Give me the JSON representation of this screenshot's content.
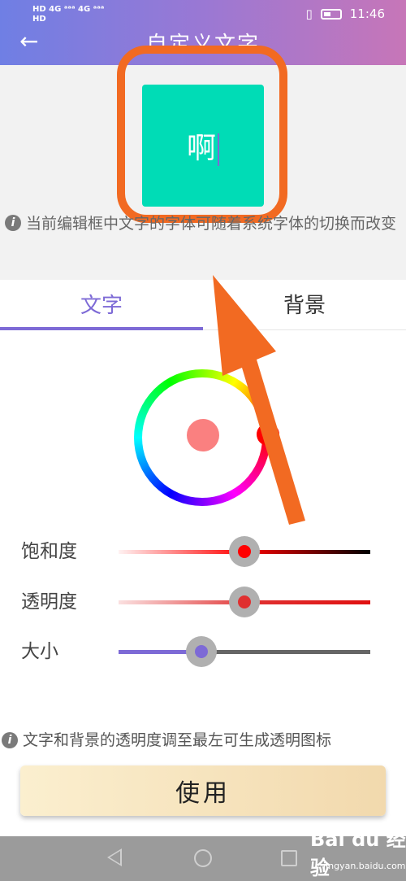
{
  "status_bar": {
    "left_line1": "HD 4G ᵃᵃᵃ 4G ᵃᵃᵃ",
    "left_line2": "HD",
    "time": "11:46"
  },
  "header": {
    "title": "自定义文字"
  },
  "preview": {
    "text": "啊",
    "info": "当前编辑框中文字的字体可随着系统字体的切换而改变"
  },
  "tabs": [
    {
      "label": "文字",
      "active": true
    },
    {
      "label": "背景",
      "active": false
    }
  ],
  "color_wheel": {
    "selected_color": "#fa8080"
  },
  "sliders": [
    {
      "label": "饱和度",
      "value": 0.5,
      "color": "#ff0000"
    },
    {
      "label": "透明度",
      "value": 0.5,
      "color": "#e03030"
    },
    {
      "label": "大小",
      "value": 0.33,
      "color": "#7d6ad6"
    }
  ],
  "note": "文字和背景的透明度调至最左可生成透明图标",
  "use_button": "使用",
  "watermark": {
    "brand": "Bai du 经验",
    "site": "jingyan.baidu.com"
  },
  "colors": {
    "accent": "#7d6ad6",
    "preview_bg": "#00dcb6",
    "annotation": "#f26a22"
  }
}
